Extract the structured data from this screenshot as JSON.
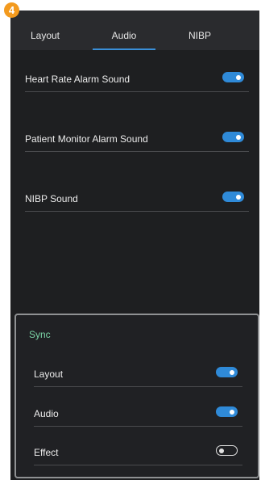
{
  "step_badge": "4",
  "tabs": [
    {
      "label": "Layout",
      "active": false
    },
    {
      "label": "Audio",
      "active": true
    },
    {
      "label": "NIBP",
      "active": false
    }
  ],
  "settings": [
    {
      "label": "Heart Rate Alarm Sound",
      "enabled": true
    },
    {
      "label": "Patient Monitor Alarm Sound",
      "enabled": true
    },
    {
      "label": "NIBP Sound",
      "enabled": true
    }
  ],
  "sync": {
    "title": "Sync",
    "items": [
      {
        "label": "Layout",
        "enabled": true
      },
      {
        "label": "Audio",
        "enabled": true
      },
      {
        "label": "Effect",
        "enabled": false
      }
    ]
  },
  "colors": {
    "background": "#1e1f21",
    "tabbar": "#2a2b2e",
    "accent": "#2f8ad8",
    "sync_title": "#7bd4a6",
    "badge": "#f39a1e"
  }
}
